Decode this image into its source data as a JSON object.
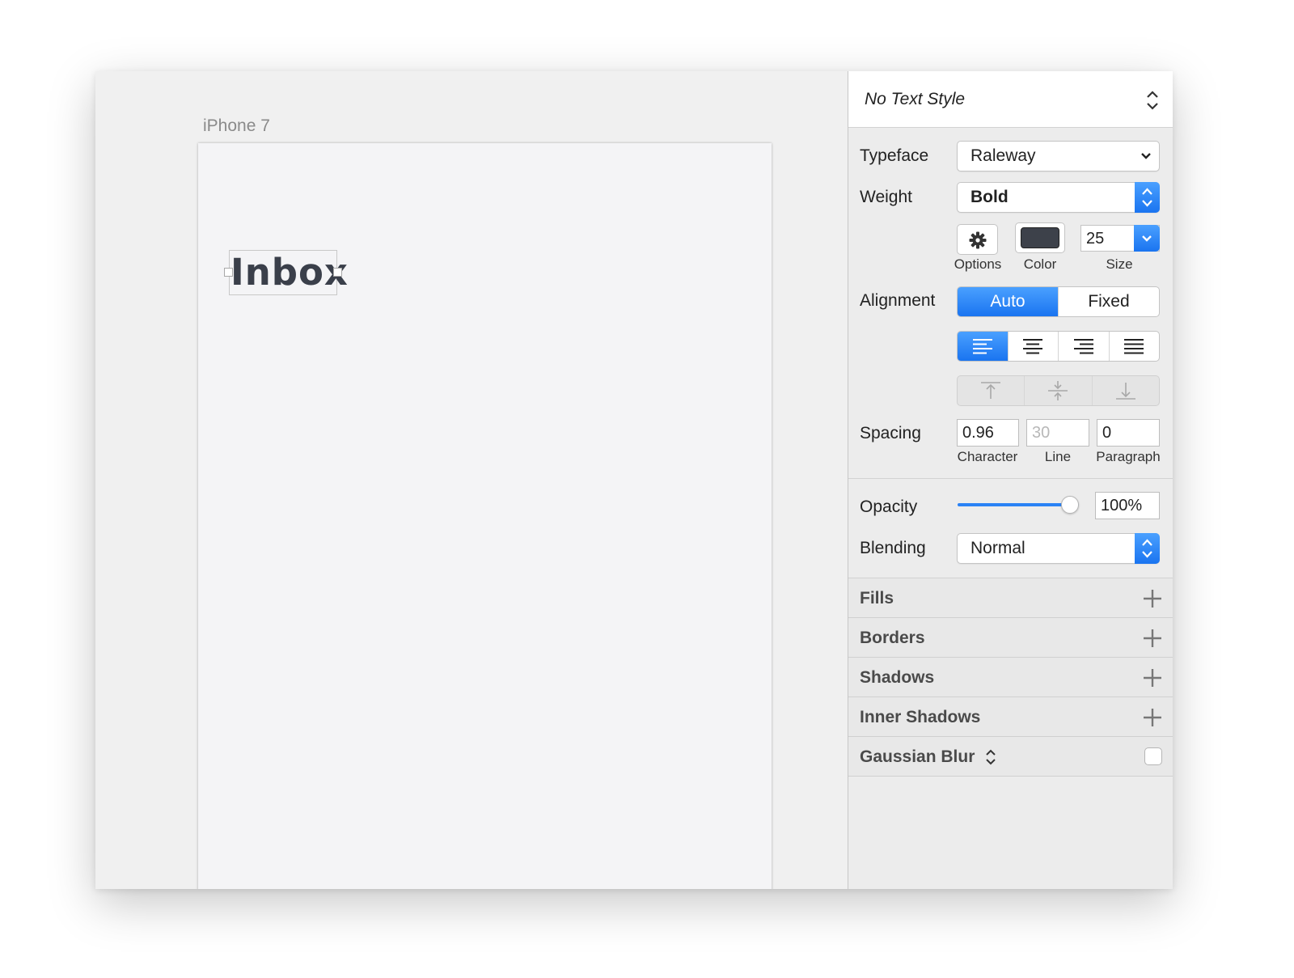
{
  "canvas": {
    "artboard_label": "iPhone 7",
    "text_layer": "Inbox"
  },
  "inspector": {
    "text_style": "No Text Style",
    "typeface": {
      "label": "Typeface",
      "value": "Raleway"
    },
    "weight": {
      "label": "Weight",
      "value": "Bold"
    },
    "options": {
      "label": "Options"
    },
    "color": {
      "label": "Color",
      "swatch": "#3d414a"
    },
    "size": {
      "label": "Size",
      "value": "25"
    },
    "alignment": {
      "label": "Alignment",
      "modes": [
        "Auto",
        "Fixed"
      ],
      "active_mode": "Auto"
    },
    "text_align": [
      "align-left-icon",
      "align-center-icon",
      "align-right-icon",
      "align-justify-icon"
    ],
    "vertical_align": [
      "align-top-icon",
      "align-middle-icon",
      "align-bottom-icon"
    ],
    "spacing": {
      "label": "Spacing",
      "character": {
        "label": "Character",
        "value": "0.96"
      },
      "line": {
        "label": "Line",
        "placeholder": "30"
      },
      "paragraph": {
        "label": "Paragraph",
        "value": "0"
      }
    },
    "opacity": {
      "label": "Opacity",
      "value": "100%",
      "level": 1.0
    },
    "blending": {
      "label": "Blending",
      "value": "Normal"
    },
    "sections": {
      "fills": "Fills",
      "borders": "Borders",
      "shadows": "Shadows",
      "inner_shadows": "Inner Shadows",
      "gaussian_blur": "Gaussian Blur"
    },
    "accent_color": "#1f7cf2"
  }
}
